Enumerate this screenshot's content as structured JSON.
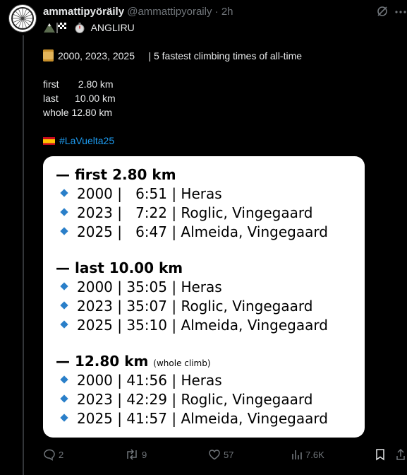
{
  "post": {
    "display_name": "ammattipyöräily",
    "handle": "@ammattipyoraily",
    "separator": " · ",
    "time": "2h",
    "line1": "ANGLIRU",
    "line2": "2000, 2023, 2025     | 5 fastest climbing times of all-time",
    "stats": [
      "first       2.80 km",
      "last      10.00 km",
      "whole 12.80 km"
    ],
    "hashtag": "#LaVuelta25"
  },
  "card": {
    "sections": [
      {
        "title": "— first 2.80 km",
        "note": "",
        "rows": [
          "2000 |   6:51 | Heras",
          "2023 |   7:22 | Roglic, Vingegaard",
          "2025 |   6:47 | Almeida, Vingegaard"
        ]
      },
      {
        "title": "— last 10.00 km",
        "note": "",
        "rows": [
          "2000 | 35:05 | Heras",
          "2023 | 35:07 | Roglic, Vingegaard",
          "2025 | 35:10 | Almeida, Vingegaard"
        ]
      },
      {
        "title": "— 12.80 km",
        "note": "(whole climb)",
        "rows": [
          "2000 | 41:56 | Heras",
          "2023 | 42:29 | Roglic, Vingegaard",
          "2025 | 41:57 | Almeida, Vingegaard"
        ]
      }
    ]
  },
  "actions": {
    "replies": "2",
    "reposts": "9",
    "likes": "57",
    "views": "7.6K"
  },
  "icons": {
    "avatar": "bicycle-wheel-icon",
    "grok": "grok-icon",
    "more": "more-icon",
    "line1_emojis": [
      "mountain-icon",
      "checkered-flag-icon",
      "stopwatch-icon"
    ],
    "line2_emoji": "scroll-icon",
    "hashtag_emoji": "spain-flag-icon",
    "bullet": "blue-diamond-icon",
    "reply": "reply-icon",
    "repost": "repost-icon",
    "like": "heart-icon",
    "views": "views-icon",
    "bookmark": "bookmark-icon"
  },
  "colors": {
    "background": "#000000",
    "text": "#e7e9ea",
    "muted": "#71767b",
    "link": "#1d9bf0",
    "card": "#ffffff",
    "bullet": "#2a7fc9"
  }
}
